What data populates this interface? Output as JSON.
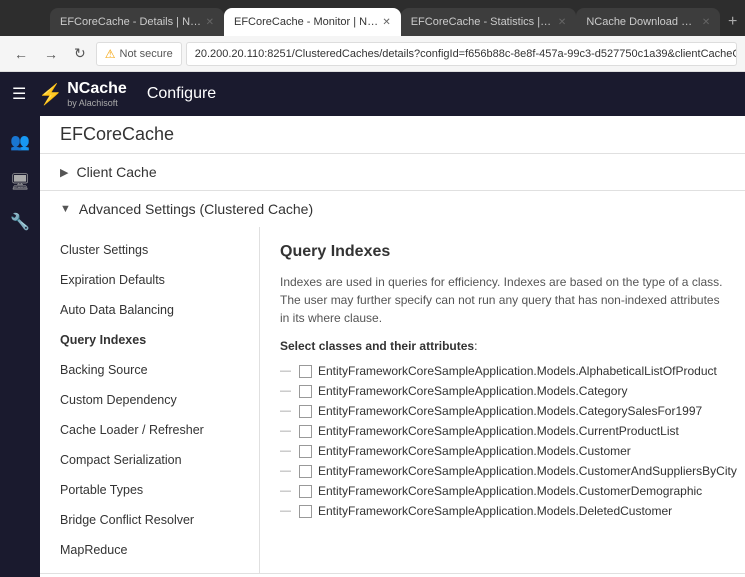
{
  "browser": {
    "tabs": [
      {
        "id": "t1",
        "label": "EFCoreCache - Details | NCache",
        "active": false
      },
      {
        "id": "t2",
        "label": "EFCoreCache - Monitor | NCache",
        "active": true
      },
      {
        "id": "t3",
        "label": "EFCoreCache - Statistics | NCa...",
        "active": false
      },
      {
        "id": "t4",
        "label": "NCache Download Center",
        "active": false
      }
    ],
    "security_text": "Not secure",
    "address": "20.200.20.110:8251/ClusteredCaches/details?configId=f656b88c-8e8f-457a-99c3-d527750c1a39&clientCacheConfigId=",
    "back_disabled": false,
    "forward_disabled": true
  },
  "app": {
    "title": "Configure",
    "logo_text": "NCache",
    "logo_sub": "by Alachisoft"
  },
  "cache": {
    "name": "EFCoreCache"
  },
  "sections": [
    {
      "label": "Client Cache",
      "collapsed": true,
      "arrow": "▶"
    },
    {
      "label": "Advanced Settings (Clustered Cache)",
      "collapsed": false,
      "arrow": "▼"
    }
  ],
  "left_nav": {
    "items": [
      {
        "label": "Cluster Settings",
        "active": false
      },
      {
        "label": "Expiration Defaults",
        "active": false
      },
      {
        "label": "Auto Data Balancing",
        "active": false
      },
      {
        "label": "Query Indexes",
        "active": true
      },
      {
        "label": "Backing Source",
        "active": false
      },
      {
        "label": "Custom Dependency",
        "active": false
      },
      {
        "label": "Cache Loader / Refresher",
        "active": false
      },
      {
        "label": "Compact Serialization",
        "active": false
      },
      {
        "label": "Portable Types",
        "active": false
      },
      {
        "label": "Bridge Conflict Resolver",
        "active": false
      },
      {
        "label": "MapReduce",
        "active": false
      }
    ]
  },
  "panel": {
    "title": "Query Indexes",
    "description": "Indexes are used in queries for efficiency. Indexes are based on the type of a class. The user may further specify can not run any query that has non-indexed attributes in its where clause.",
    "select_label": "Select classes and their attributes",
    "classes": [
      "EntityFrameworkCoreSampleApplication.Models.AlphabeticalListOfProduct",
      "EntityFrameworkCoreSampleApplication.Models.Category",
      "EntityFrameworkCoreSampleApplication.Models.CategorySalesFor1997",
      "EntityFrameworkCoreSampleApplication.Models.CurrentProductList",
      "EntityFrameworkCoreSampleApplication.Models.Customer",
      "EntityFrameworkCoreSampleApplication.Models.CustomerAndSuppliersByCity",
      "EntityFrameworkCoreSampleApplication.Models.CustomerDemographic",
      "EntityFrameworkCoreSampleApplication.Models.DeletedCustomer"
    ]
  },
  "icons": {
    "hamburger": "☰",
    "people": "👥",
    "monitor": "🖥",
    "wrench": "🔧",
    "back": "←",
    "forward": "→",
    "refresh": "↻",
    "security_warning": "⚠"
  }
}
